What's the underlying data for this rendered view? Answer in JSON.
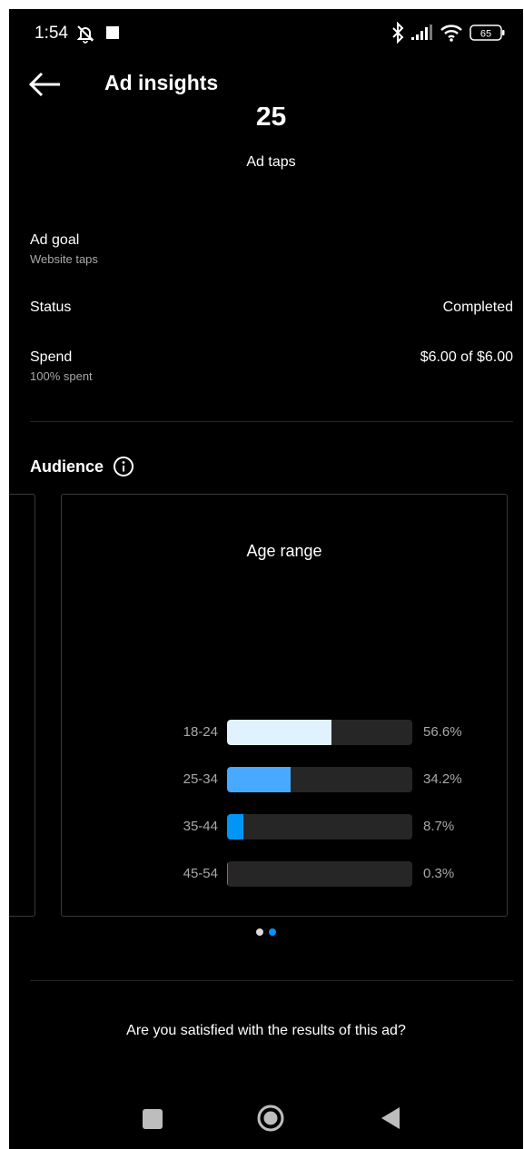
{
  "status_bar": {
    "time": "1:54",
    "battery": "65"
  },
  "header": {
    "title": "Ad insights"
  },
  "metric": {
    "value": "25",
    "label": "Ad taps"
  },
  "details": {
    "ad_goal": {
      "label": "Ad goal",
      "value": "Website taps"
    },
    "status": {
      "label": "Status",
      "value": "Completed"
    },
    "spend": {
      "label": "Spend",
      "sub": "100% spent",
      "value": "$6.00 of $6.00"
    }
  },
  "audience": {
    "title": "Audience",
    "cards": [
      {
        "title": "Age range",
        "bars": [
          {
            "label": "18-24",
            "percent_text": "56.6%",
            "value": 56.6,
            "color": "#e0f1ff"
          },
          {
            "label": "25-34",
            "percent_text": "34.2%",
            "value": 34.2,
            "color": "#47a9ff"
          },
          {
            "label": "35-44",
            "percent_text": "8.7%",
            "value": 8.7,
            "color": "#0095f6"
          },
          {
            "label": "45-54",
            "percent_text": "0.3%",
            "value": 0.3,
            "color": "#0095f6"
          }
        ]
      }
    ],
    "pager": {
      "count": 2,
      "active": 1,
      "active_color": "#0095f6",
      "inactive_color": "#dbdbdb"
    }
  },
  "feedback": {
    "question": "Are you satisfied with the results of this ad?"
  },
  "colors": {
    "background": "#000000",
    "divider": "#262626",
    "bar_track": "#262626"
  }
}
